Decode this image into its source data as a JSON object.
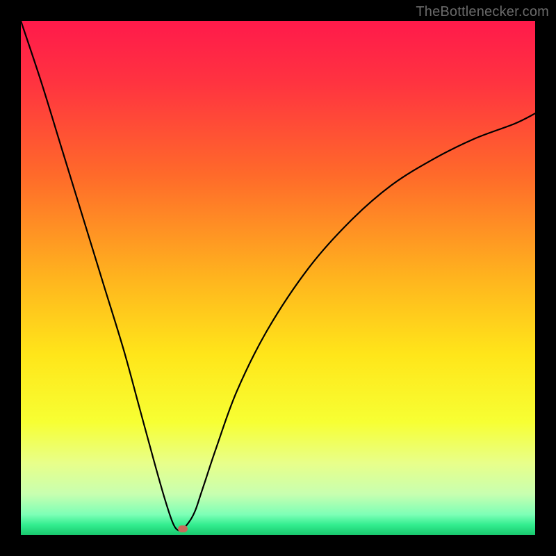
{
  "watermark": {
    "text": "TheBottlenecker.com"
  },
  "chart_data": {
    "type": "line",
    "title": "",
    "xlabel": "",
    "ylabel": "",
    "xlim": [
      0,
      100
    ],
    "ylim": [
      0,
      100
    ],
    "gradient_stops": [
      {
        "offset": 0,
        "color": "#ff1a4b"
      },
      {
        "offset": 12,
        "color": "#ff3340"
      },
      {
        "offset": 30,
        "color": "#ff6a2a"
      },
      {
        "offset": 50,
        "color": "#ffb41e"
      },
      {
        "offset": 65,
        "color": "#ffe61a"
      },
      {
        "offset": 78,
        "color": "#f7ff33"
      },
      {
        "offset": 86,
        "color": "#e8ff8a"
      },
      {
        "offset": 92,
        "color": "#c8ffb0"
      },
      {
        "offset": 96,
        "color": "#7dffb6"
      },
      {
        "offset": 98,
        "color": "#33ed8f"
      },
      {
        "offset": 100,
        "color": "#18c76d"
      }
    ],
    "series": [
      {
        "name": "bottleneck-curve",
        "color": "#000000",
        "x": [
          0,
          4,
          8,
          12,
          16,
          20,
          23,
          26,
          28,
          29.5,
          30.5,
          31.5,
          33,
          34,
          35,
          36,
          38,
          42,
          48,
          56,
          64,
          72,
          80,
          88,
          96,
          100
        ],
        "values": [
          100,
          88,
          75,
          62,
          49,
          36,
          25,
          14,
          7,
          2.5,
          1,
          1.2,
          3,
          5,
          8,
          11,
          17,
          28,
          40,
          52,
          61,
          68,
          73,
          77,
          80,
          82
        ]
      }
    ],
    "marker": {
      "x": 31.5,
      "y": 1.2,
      "color": "#c86a5a"
    },
    "minimum_x": 30.5
  }
}
